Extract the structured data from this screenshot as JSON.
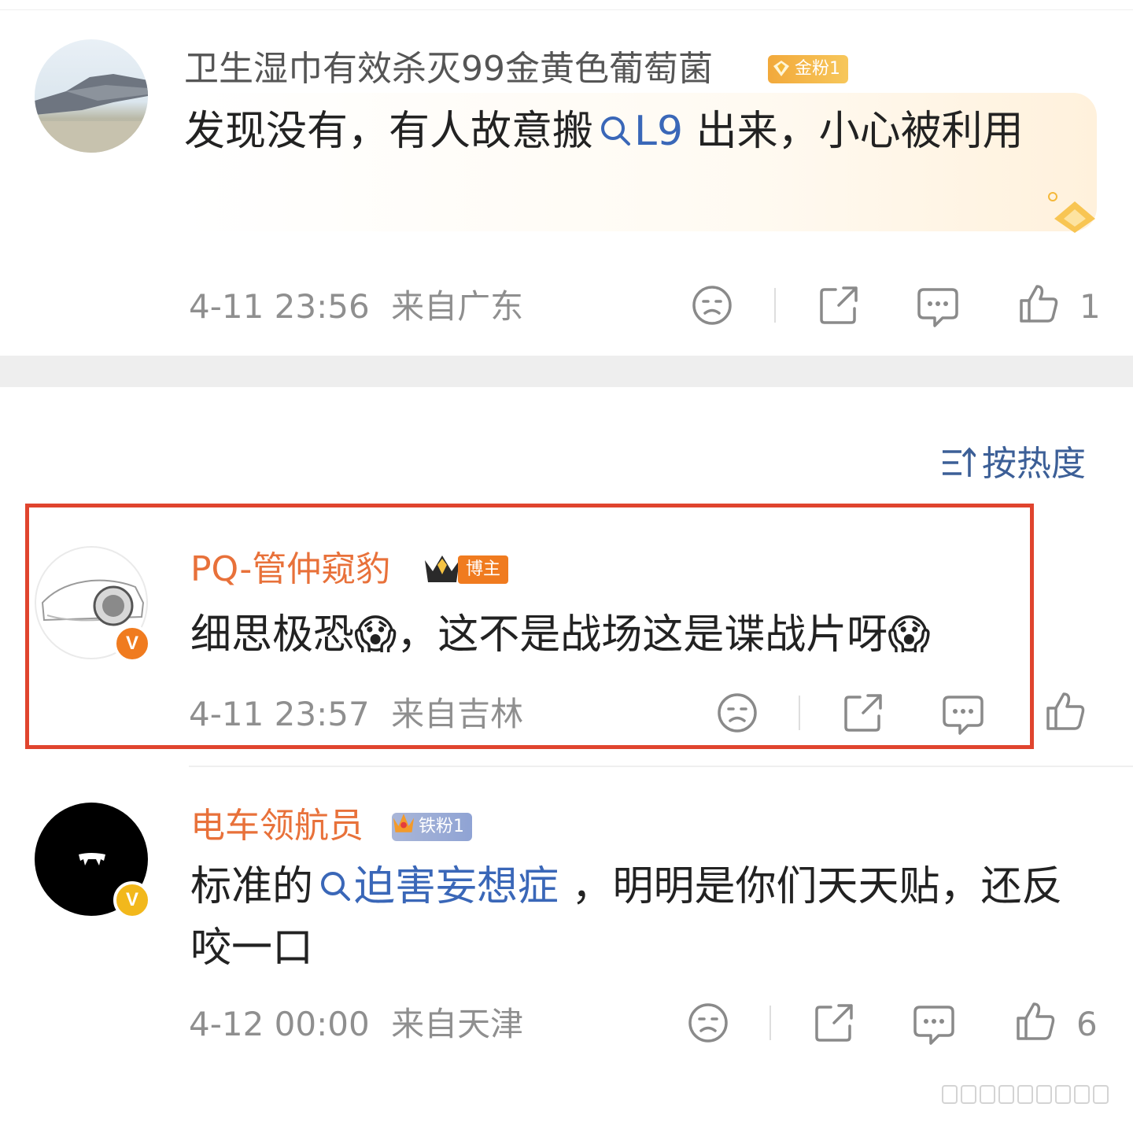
{
  "sort_label": "按热度",
  "comments": [
    {
      "username": "卫生湿巾有效杀灭99金黄色葡萄菌",
      "badge": "金粉1",
      "content_before": "发现没有，有人故意搬",
      "content_link": "L9",
      "content_after": " 出来，小心被利用",
      "time": "4-11 23:56",
      "location": "来自广东",
      "like_count": "1",
      "avatar_icon": "fighter-jet-photo-avatar"
    },
    {
      "username": "PQ-管仲窥豹",
      "badge": "博主",
      "content": "细思极恐😱，这不是战场这是谍战片呀😱",
      "time": "4-11 23:57",
      "location": "来自吉林",
      "like_count": "",
      "avatar_icon": "car-sketch-avatar",
      "verified": "V",
      "highlighted": true
    },
    {
      "username": "电车领航员",
      "badge": "铁粉1",
      "content_before": "标准的",
      "content_link": "迫害妄想症",
      "content_after": " ，明明是你们天天贴，还反咬一口",
      "time": "4-12 00:00",
      "location": "来自天津",
      "like_count": "6",
      "avatar_icon": "fangs-avatar",
      "verified": "V"
    }
  ],
  "colors": {
    "link": "#3a67b8",
    "orange_name": "#e8713a",
    "highlight_border": "#e0442e",
    "gold_badge": "#f5b83a",
    "meta_gray": "#8f8f8f"
  }
}
